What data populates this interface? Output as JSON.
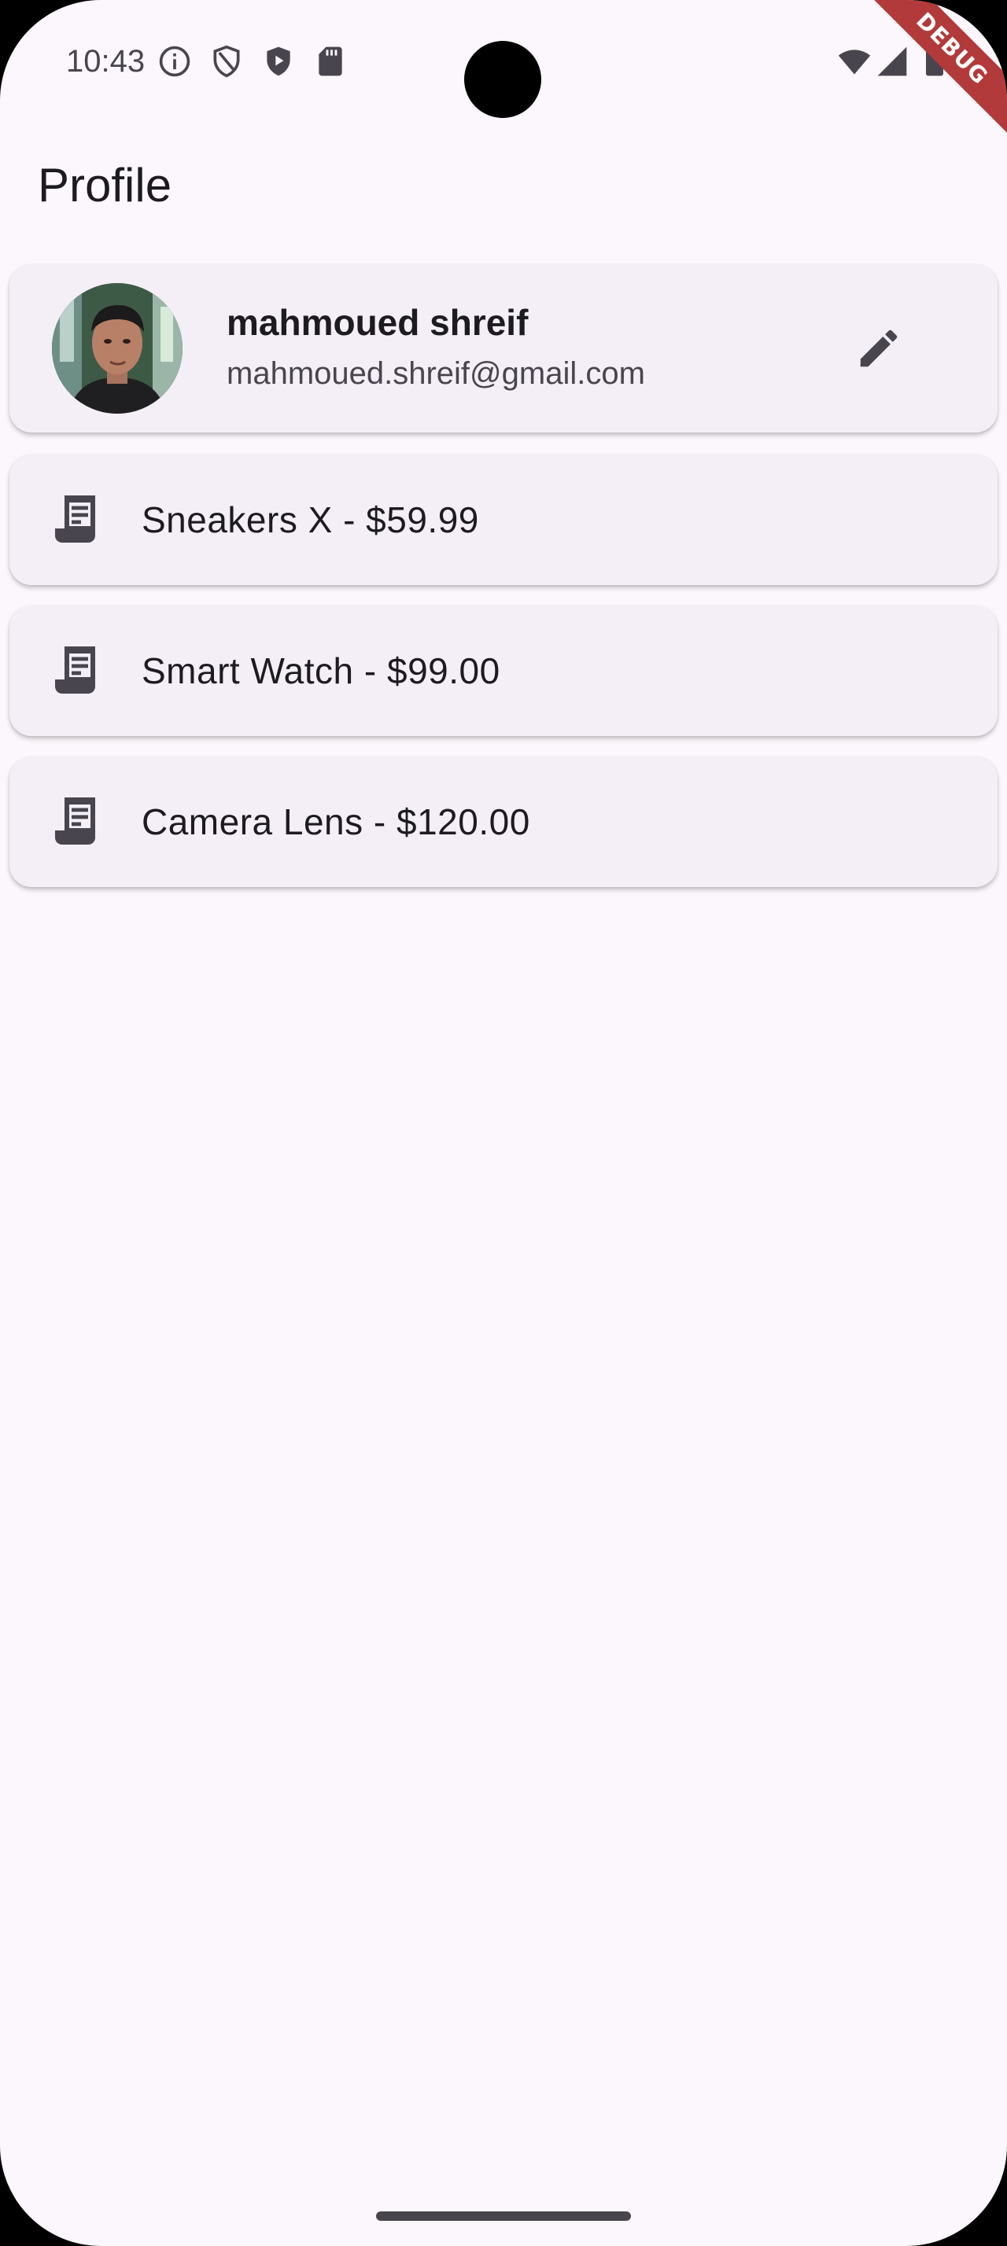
{
  "status_bar": {
    "time": "10:43",
    "left_icons": [
      "info-icon",
      "shield-outline-icon",
      "shield-play-icon",
      "sd-card-icon"
    ],
    "right_icons": [
      "wifi-icon",
      "signal-icon",
      "battery-icon"
    ],
    "debug_label": "DEBUG"
  },
  "app_bar": {
    "title": "Profile"
  },
  "profile": {
    "name": "mahmoued shreif",
    "email": "mahmoued.shreif@gmail.com",
    "edit_icon": "pencil-icon"
  },
  "orders": [
    {
      "label": "Sneakers X - $59.99",
      "icon": "receipt-icon"
    },
    {
      "label": "Smart Watch - $99.00",
      "icon": "receipt-icon"
    },
    {
      "label": "Camera Lens - $120.00",
      "icon": "receipt-icon"
    }
  ],
  "colors": {
    "background": "#fcf7fc",
    "card": "#f4eff6",
    "text_primary": "#1d1b20",
    "text_secondary": "#49454f",
    "debug_banner": "#b23a3a"
  }
}
